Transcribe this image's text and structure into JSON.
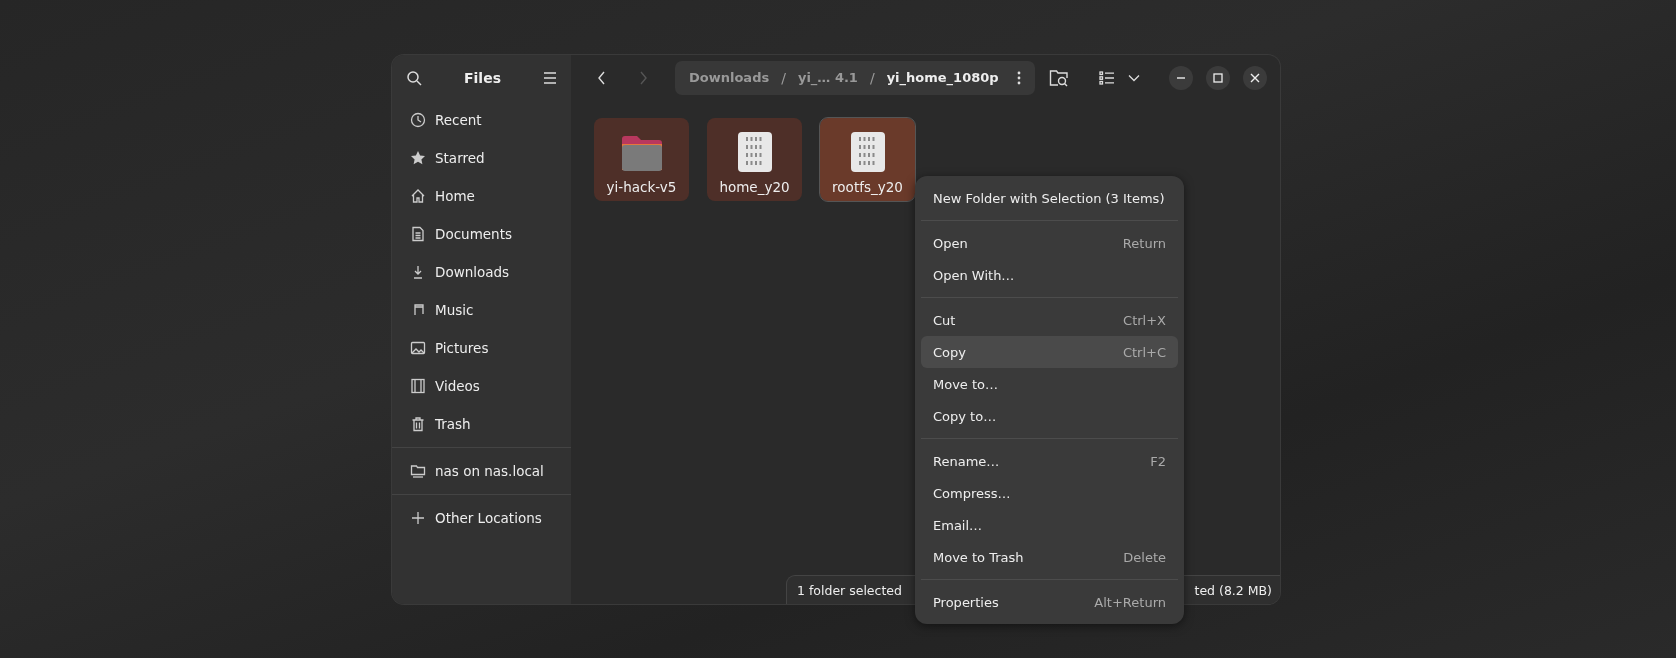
{
  "sidebar": {
    "title": "Files",
    "sections": [
      [
        {
          "label": "Recent"
        },
        {
          "label": "Starred"
        },
        {
          "label": "Home"
        },
        {
          "label": "Documents"
        },
        {
          "label": "Downloads"
        },
        {
          "label": "Music"
        },
        {
          "label": "Pictures"
        },
        {
          "label": "Videos"
        },
        {
          "label": "Trash"
        }
      ],
      [
        {
          "label": "nas on nas.local"
        }
      ],
      [
        {
          "label": "Other Locations"
        }
      ]
    ]
  },
  "toolbar": {
    "separator": "/",
    "back_disabled": false,
    "forward_disabled": true,
    "breadcrumbs": [
      {
        "label": "Downloads",
        "current": false
      },
      {
        "label": "yi_… 4.1",
        "current": false
      },
      {
        "label": "yi_home_1080p",
        "current": true
      }
    ]
  },
  "files": [
    {
      "name": "yi-hack-v5",
      "kind": "folder",
      "selected": true,
      "hovered": false
    },
    {
      "name": "home_y20",
      "kind": "binary",
      "selected": true,
      "hovered": false
    },
    {
      "name": "rootfs_y20",
      "kind": "binary",
      "selected": true,
      "hovered": true
    }
  ],
  "context_menu": {
    "sections": [
      [
        {
          "label": "New Folder with Selection (3 Items)",
          "selected": false
        }
      ],
      [
        {
          "label": "Open",
          "shortcut": "Return",
          "selected": false
        },
        {
          "label": "Open With…",
          "selected": false
        }
      ],
      [
        {
          "label": "Cut",
          "shortcut": "Ctrl+X",
          "selected": false
        },
        {
          "label": "Copy",
          "shortcut": "Ctrl+C",
          "selected": true
        },
        {
          "label": "Move to…",
          "selected": false
        },
        {
          "label": "Copy to…",
          "selected": false
        }
      ],
      [
        {
          "label": "Rename…",
          "shortcut": "F2",
          "selected": false
        },
        {
          "label": "Compress…",
          "selected": false
        },
        {
          "label": "Email…",
          "selected": false
        },
        {
          "label": "Move to Trash",
          "shortcut": "Delete",
          "selected": false
        }
      ],
      [
        {
          "label": "Properties",
          "shortcut": "Alt+Return",
          "selected": false
        }
      ]
    ]
  },
  "status_bar": {
    "left": "1 folder selected",
    "right": "ted (8.2 MB)"
  }
}
